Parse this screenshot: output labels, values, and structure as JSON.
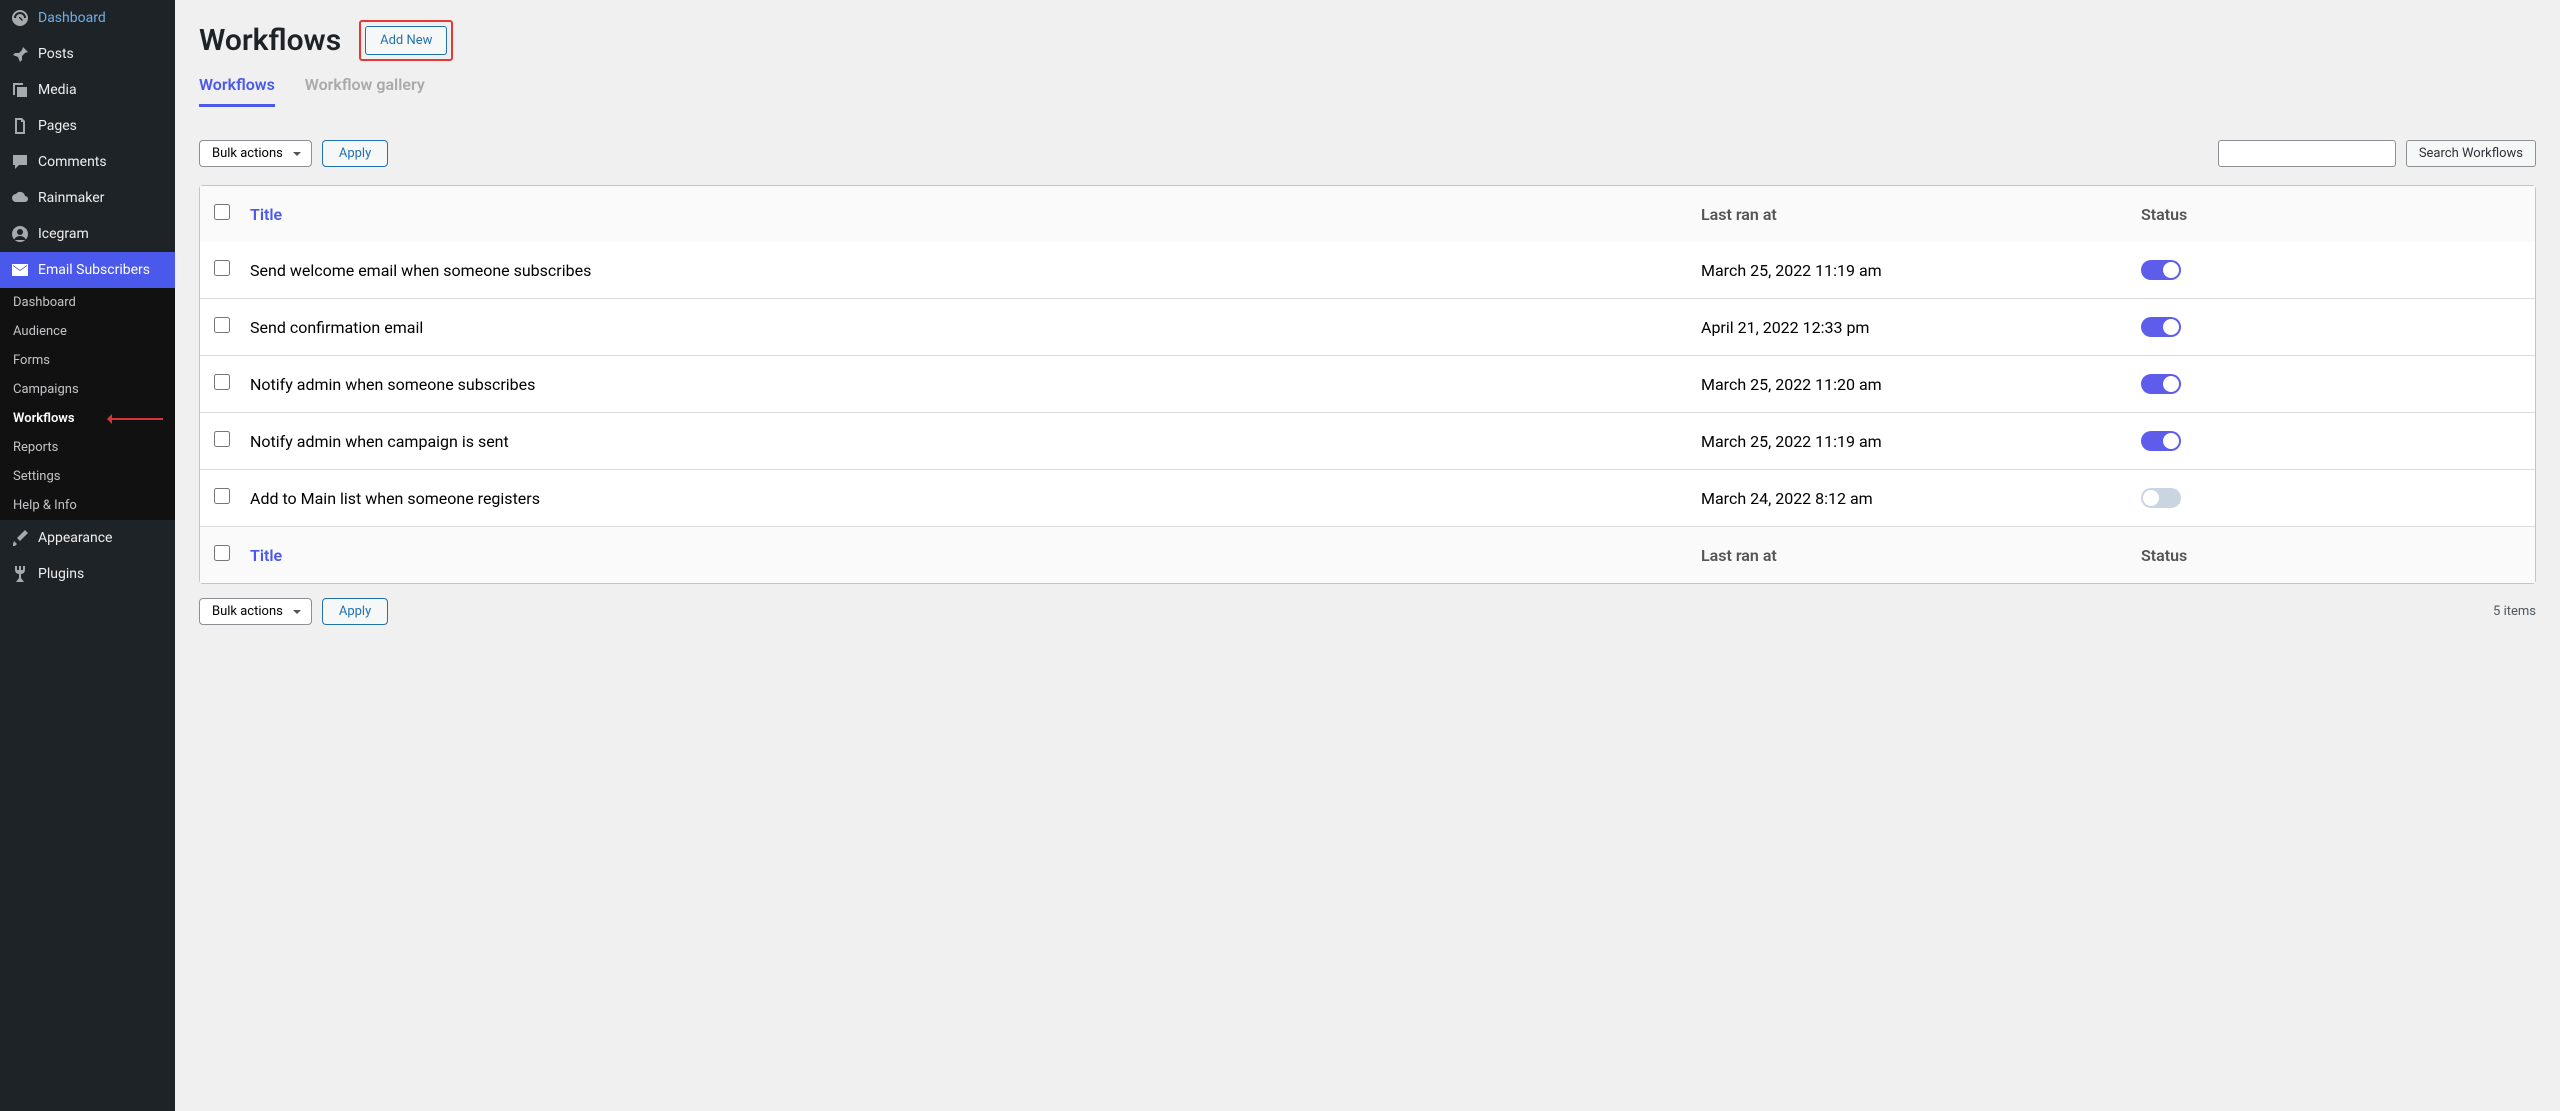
{
  "sidebar": {
    "main": [
      {
        "id": "dashboard",
        "label": "Dashboard",
        "icon": "gauge-icon"
      },
      {
        "id": "posts",
        "label": "Posts",
        "icon": "pin-icon"
      },
      {
        "id": "media",
        "label": "Media",
        "icon": "media-icon"
      },
      {
        "id": "pages",
        "label": "Pages",
        "icon": "page-icon"
      },
      {
        "id": "comments",
        "label": "Comments",
        "icon": "comment-icon"
      },
      {
        "id": "rainmaker",
        "label": "Rainmaker",
        "icon": "cloud-icon"
      },
      {
        "id": "icegram",
        "label": "Icegram",
        "icon": "user-circle-icon"
      },
      {
        "id": "email-subscribers",
        "label": "Email Subscribers",
        "icon": "mail-icon",
        "active": true
      }
    ],
    "sub": [
      {
        "id": "sub-dashboard",
        "label": "Dashboard"
      },
      {
        "id": "sub-audience",
        "label": "Audience"
      },
      {
        "id": "sub-forms",
        "label": "Forms"
      },
      {
        "id": "sub-campaigns",
        "label": "Campaigns"
      },
      {
        "id": "sub-workflows",
        "label": "Workflows",
        "highlight": true,
        "arrow": true
      },
      {
        "id": "sub-reports",
        "label": "Reports"
      },
      {
        "id": "sub-settings",
        "label": "Settings"
      },
      {
        "id": "sub-help",
        "label": "Help & Info"
      }
    ],
    "bottom": [
      {
        "id": "appearance",
        "label": "Appearance",
        "icon": "brush-icon"
      },
      {
        "id": "plugins",
        "label": "Plugins",
        "icon": "plug-icon"
      }
    ]
  },
  "page": {
    "title": "Workflows",
    "add_new": "Add New",
    "tabs": [
      "Workflows",
      "Workflow gallery"
    ],
    "bulk_label": "Bulk actions",
    "apply_label": "Apply",
    "search_btn": "Search Workflows",
    "title_col": "Title",
    "date_col": "Last ran at",
    "status_col": "Status",
    "items_count": "5 items"
  },
  "rows": [
    {
      "title": "Send welcome email when someone subscribes",
      "date": "March 25, 2022 11:19 am",
      "on": true
    },
    {
      "title": "Send confirmation email",
      "date": "April 21, 2022 12:33 pm",
      "on": true
    },
    {
      "title": "Notify admin when someone subscribes",
      "date": "March 25, 2022 11:20 am",
      "on": true
    },
    {
      "title": "Notify admin when campaign is sent",
      "date": "March 25, 2022 11:19 am",
      "on": true
    },
    {
      "title": "Add to Main list when someone registers",
      "date": "March 24, 2022 8:12 am",
      "on": false
    }
  ]
}
